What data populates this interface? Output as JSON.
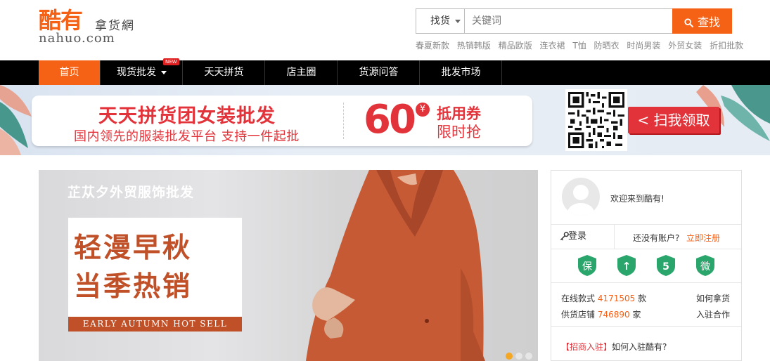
{
  "logo": {
    "cn": "酷有",
    "tagline": "拿货網",
    "en": "nahuo.com"
  },
  "search": {
    "type_label": "找货",
    "placeholder": "关键词",
    "button_label": "查找",
    "hotwords": [
      "春夏新款",
      "热销韩版",
      "精品欧版",
      "连衣裙",
      "T恤",
      "防晒衣",
      "时尚男装",
      "外贸女装",
      "折扣批款"
    ]
  },
  "nav": {
    "items": [
      "首页",
      "现货批发",
      "天天拼货",
      "店主圈",
      "货源问答",
      "批发市场"
    ],
    "new_badge": "NEW",
    "active_color": "#f56115"
  },
  "promo": {
    "title": "天天拼货团女装批发",
    "subtitle": "国内领先的服装批发平台  支持一件起批",
    "amount": "60",
    "currency": "¥",
    "coupon": "抵用券",
    "limited": "限时抢",
    "scan_label": "< 扫我领取",
    "accent_color": "#e3333a"
  },
  "slider": {
    "shop_name": "芷苁夕外贸服饰批发",
    "headline_1": "轻漫早秋",
    "headline_2": "当季热销",
    "english": "EARLY AUTUMN HOT SELL",
    "dots": 3,
    "active_dot": 1
  },
  "user_panel": {
    "welcome": "欢迎来到酷有!",
    "login_label": "登录",
    "register_question": "还没有账户?",
    "register_link": "立即注册",
    "badges": [
      {
        "icon": "shield-bao-icon",
        "glyph": "保"
      },
      {
        "icon": "shield-up-icon",
        "glyph": "↑"
      },
      {
        "icon": "shield-five-icon",
        "glyph": "5"
      },
      {
        "icon": "shield-wei-icon",
        "glyph": "微"
      }
    ],
    "stats": {
      "styles_label": "在线款式",
      "styles_count": "4171505",
      "styles_unit": "款",
      "shops_label": "供货店铺",
      "shops_count": "746890",
      "shops_unit": "家",
      "how_to_buy": "如何拿货",
      "join": "入驻合作"
    },
    "join_tag": "【招商入驻】",
    "join_text": "如何入驻酷有?",
    "badge_color": "#2aa56b"
  }
}
